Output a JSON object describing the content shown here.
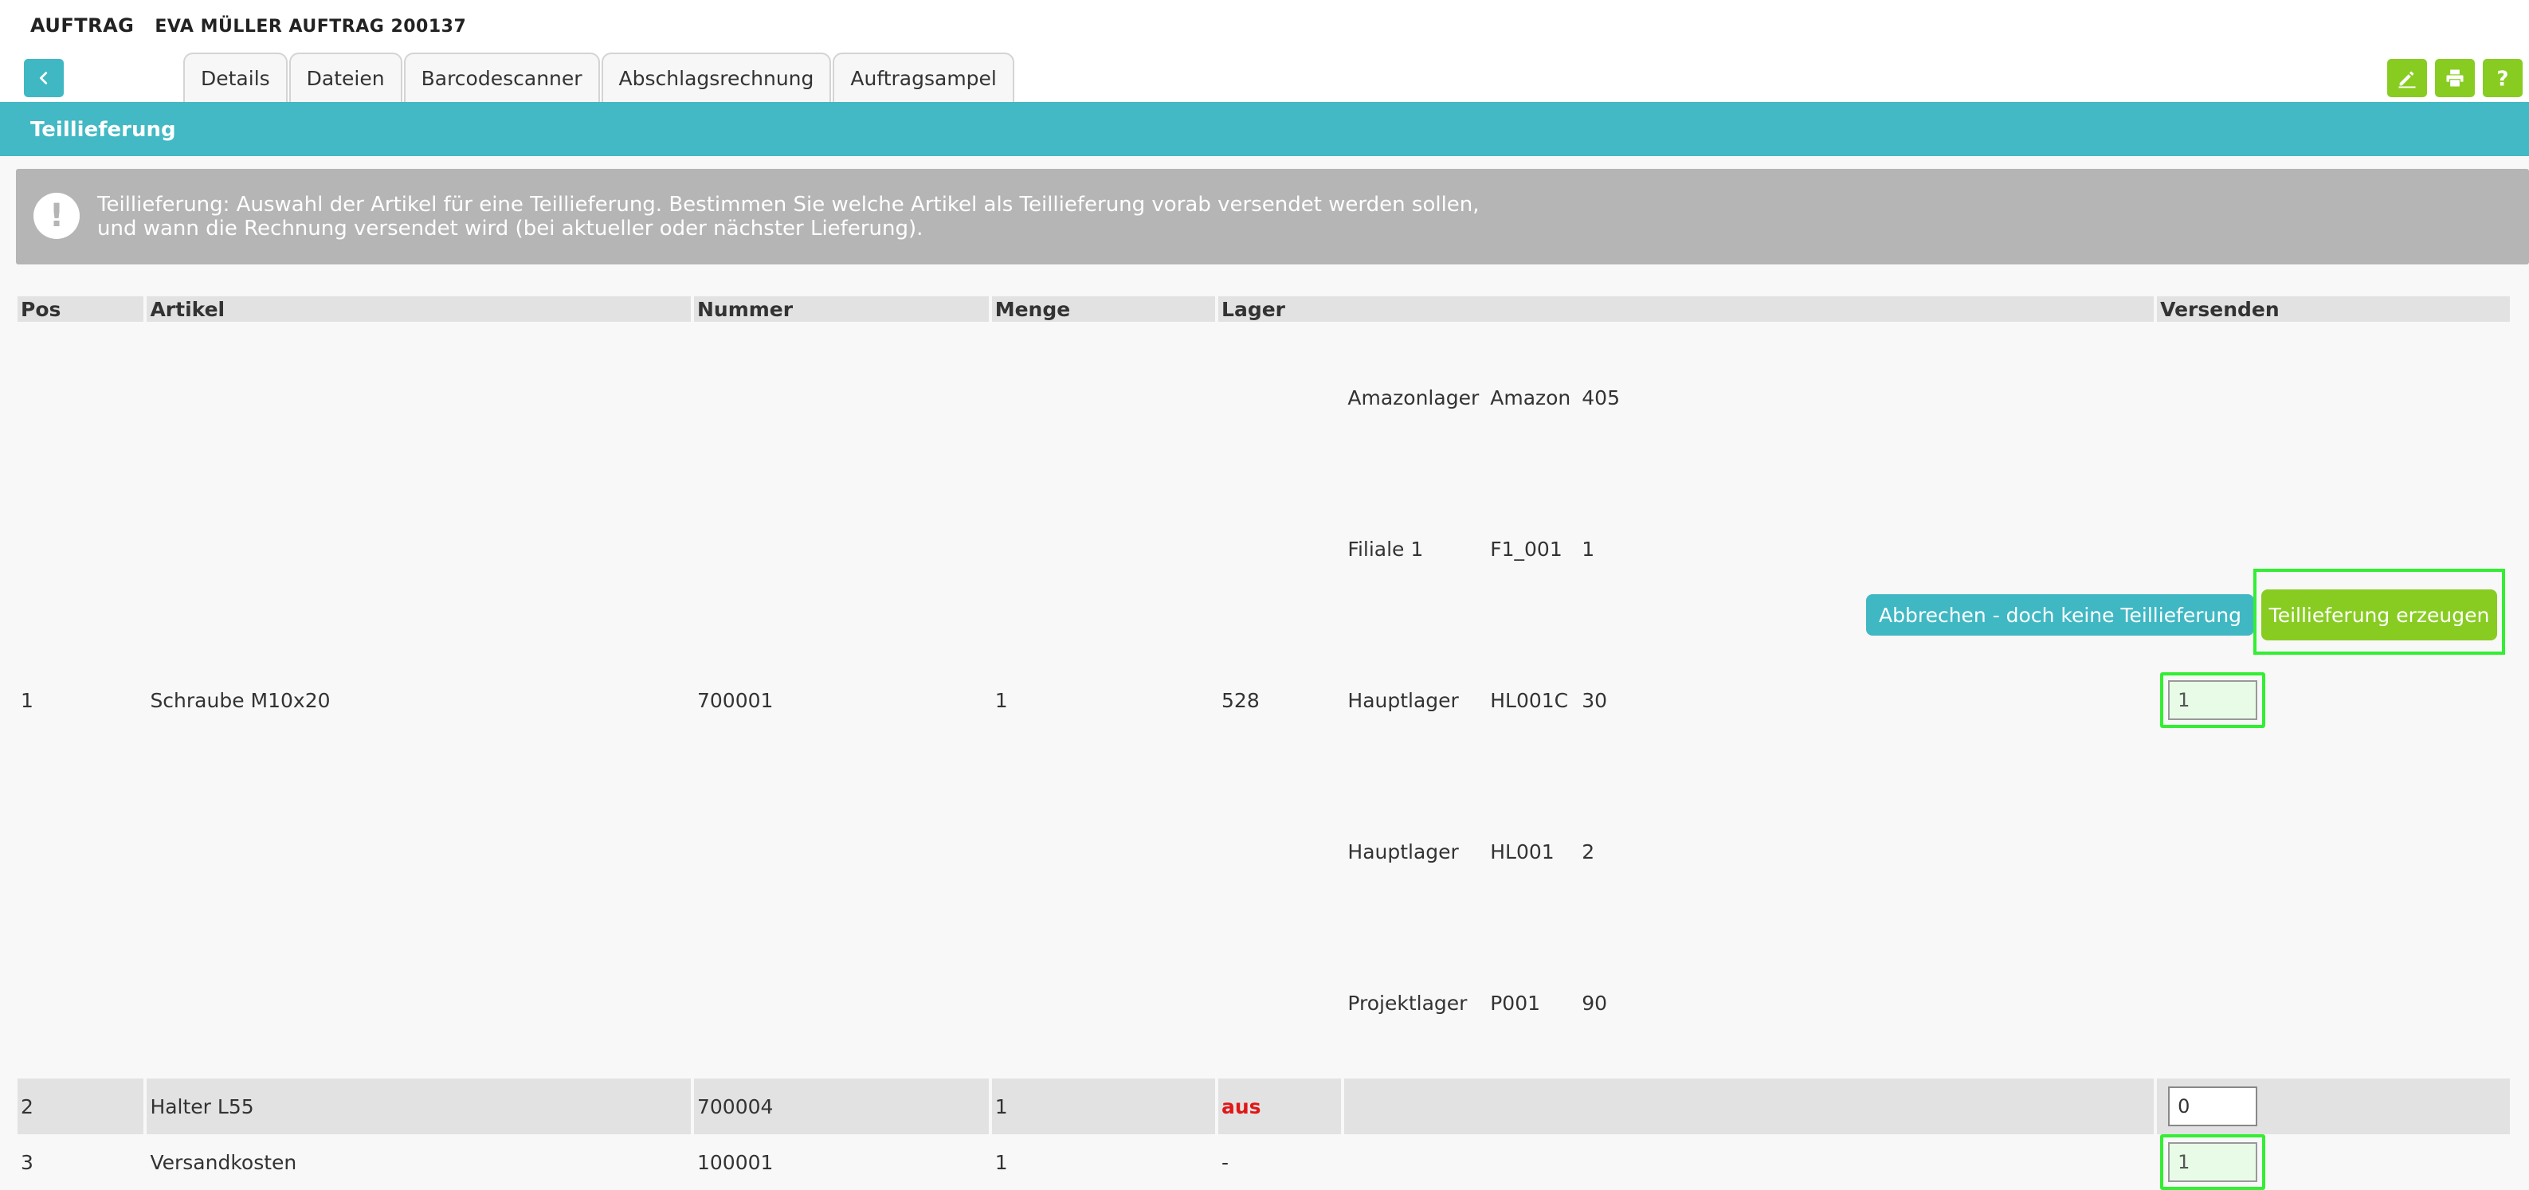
{
  "header": {
    "title": "AUFTRAG",
    "subtitle": "EVA MÜLLER AUFTRAG 200137",
    "tabs": [
      {
        "label": "Details"
      },
      {
        "label": "Dateien"
      },
      {
        "label": "Barcodescanner"
      },
      {
        "label": "Abschlagsrechnung"
      },
      {
        "label": "Auftragsampel"
      }
    ],
    "tools": [
      {
        "icon": "pencil-icon"
      },
      {
        "icon": "printer-icon"
      },
      {
        "icon": "help-icon"
      }
    ]
  },
  "section": {
    "title": "Teillieferung"
  },
  "info": {
    "icon": "exclamation-icon",
    "line1": "Teillieferung: Auswahl der Artikel für eine Teillieferung. Bestimmen Sie welche Artikel als Teillieferung vorab versendet werden sollen,",
    "line2": "und wann die Rechnung versendet wird (bei aktueller oder nächster Lieferung)."
  },
  "table": {
    "headers": {
      "pos": "Pos",
      "artikel": "Artikel",
      "nummer": "Nummer",
      "menge": "Menge",
      "lager": "Lager",
      "versenden": "Versenden"
    },
    "rows": [
      {
        "pos": "1",
        "artikel": "Schraube M10x20",
        "nummer": "700001",
        "menge": "1",
        "lager": "528",
        "stock": [
          {
            "name": "Amazonlager",
            "code": "Amazon",
            "qty": "405"
          },
          {
            "name": "Filiale 1",
            "code": "F1_001",
            "qty": "1"
          },
          {
            "name": "Hauptlager",
            "code": "HL001C",
            "qty": "30"
          },
          {
            "name": "Hauptlager",
            "code": "HL001",
            "qty": "2"
          },
          {
            "name": "Projektlager",
            "code": "P001",
            "qty": "90"
          }
        ],
        "versenden": "1"
      },
      {
        "pos": "2",
        "artikel": "Halter L55",
        "nummer": "700004",
        "menge": "1",
        "lager": "aus",
        "versenden": "0"
      },
      {
        "pos": "3",
        "artikel": "Versandkosten",
        "nummer": "100001",
        "menge": "1",
        "lager": "-",
        "versenden": "1"
      }
    ]
  },
  "actions": {
    "cancel": "Abbrechen - doch keine Teillieferung",
    "create": "Teillieferung erzeugen"
  },
  "colors": {
    "teal": "#42b9c4",
    "green": "#88cc22",
    "highlight": "#33ee33",
    "alert": "#e01818",
    "info_bg": "#b5b5b5"
  }
}
